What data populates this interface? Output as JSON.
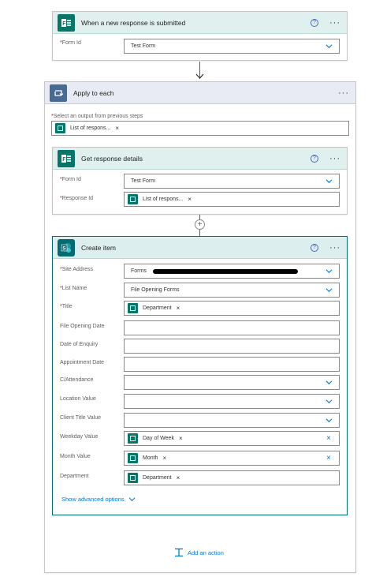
{
  "trigger": {
    "title": "When a new response is submitted",
    "form_id_label": "Form Id",
    "form_id_value": "Test Form"
  },
  "apply_to_each": {
    "title": "Apply to each",
    "select_label": "Select an output from previous steps",
    "select_token": "List of respons..."
  },
  "get_response": {
    "title": "Get response details",
    "form_id_label": "Form Id",
    "form_id_value": "Test Form",
    "response_id_label": "Response Id",
    "response_id_token": "List of respons..."
  },
  "create_item": {
    "title": "Create item",
    "fields": {
      "site_address": {
        "label": "Site Address",
        "value": "Forms"
      },
      "list_name": {
        "label": "List Name",
        "value": "File Opening Forms"
      },
      "title": {
        "label": "Title",
        "token": "Department"
      },
      "file_opening_date": {
        "label": "File Opening Date"
      },
      "date_of_enquiry": {
        "label": "Date of Enquiry"
      },
      "appointment_date": {
        "label": "Appointment Date"
      },
      "c_attendance": {
        "label": "C/Attendance"
      },
      "location_value": {
        "label": "Location Value"
      },
      "client_title_value": {
        "label": "Client Title Value"
      },
      "weekday_value": {
        "label": "Weekday Value",
        "token": "Day of Week"
      },
      "month_value": {
        "label": "Month Value",
        "token": "Month"
      },
      "department": {
        "label": "Department",
        "token": "Department"
      }
    },
    "show_advanced": "Show advanced options"
  },
  "add_action": "Add an action",
  "colors": {
    "forms_green": "#077568",
    "sharepoint_teal": "#036c70",
    "loop_blue": "#486991",
    "link_blue": "#0078d4"
  }
}
